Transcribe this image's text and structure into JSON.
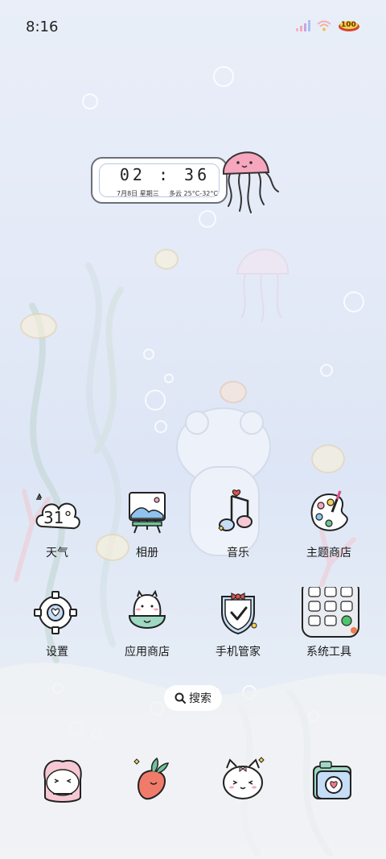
{
  "status_bar": {
    "time": "8:16",
    "battery": "100",
    "signal_icon": "signal-bars-icon",
    "wifi_icon": "wifi-icon",
    "battery_icon": "battery-icon"
  },
  "clock_widget": {
    "time": "02 : 36",
    "date": "7月8日 星期三",
    "weather": "多云 25°C-32°C"
  },
  "apps": [
    {
      "label": "天气",
      "icon": "weather-icon",
      "temp": "31°"
    },
    {
      "label": "相册",
      "icon": "gallery-icon"
    },
    {
      "label": "音乐",
      "icon": "music-icon"
    },
    {
      "label": "主题商店",
      "icon": "theme-store-icon"
    },
    {
      "label": "设置",
      "icon": "settings-icon"
    },
    {
      "label": "应用商店",
      "icon": "app-store-icon"
    },
    {
      "label": "手机管家",
      "icon": "phone-manager-icon"
    },
    {
      "label": "系统工具",
      "icon": "system-tools-folder-icon"
    }
  ],
  "search": {
    "label": "搜索",
    "icon": "search-icon"
  },
  "dock": [
    {
      "icon": "phone-dock-icon"
    },
    {
      "icon": "carrot-dock-icon"
    },
    {
      "icon": "bunny-dock-icon"
    },
    {
      "icon": "camera-dock-icon"
    }
  ],
  "colors": {
    "accent_pink": "#f3a9bd",
    "outline": "#222222",
    "bg_blue": "#e4eaf7"
  }
}
